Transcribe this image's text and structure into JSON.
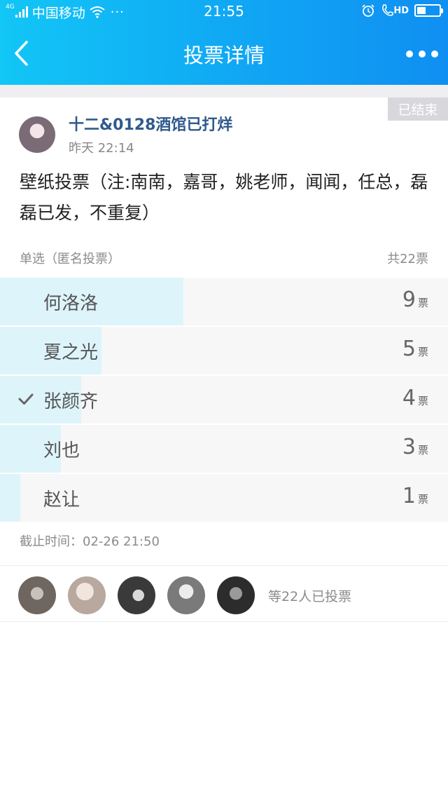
{
  "status_bar": {
    "network": "4G",
    "carrier": "中国移动",
    "more": "···",
    "time": "21:55",
    "hd": "HD"
  },
  "nav": {
    "title": "投票详情"
  },
  "post": {
    "status_tag": "已结束",
    "author": "十二&0128酒馆已打烊",
    "time": "昨天 22:14",
    "text": "壁纸投票（注:南南，嘉哥，姚老师，闻闻，任总，磊磊已发，不重复）"
  },
  "vote": {
    "mode": "单选（匿名投票）",
    "total": "共22票",
    "unit": "票",
    "options": [
      {
        "label": "何洛洛",
        "count": "9",
        "fraction": 0.409,
        "selected": false
      },
      {
        "label": "夏之光",
        "count": "5",
        "fraction": 0.227,
        "selected": false
      },
      {
        "label": "张颜齐",
        "count": "4",
        "fraction": 0.182,
        "selected": true
      },
      {
        "label": "刘也",
        "count": "3",
        "fraction": 0.136,
        "selected": false
      },
      {
        "label": "赵让",
        "count": "1",
        "fraction": 0.045,
        "selected": false
      }
    ],
    "deadline": "截止时间：02-26 21:50",
    "voters_text": "等22人已投票"
  },
  "colors": {
    "header_start": "#12c6f6",
    "header_end": "#0f8ff2",
    "author": "#2f5a8c",
    "bar_fill": "#def4fb",
    "row_bg": "#f7f7f7"
  }
}
